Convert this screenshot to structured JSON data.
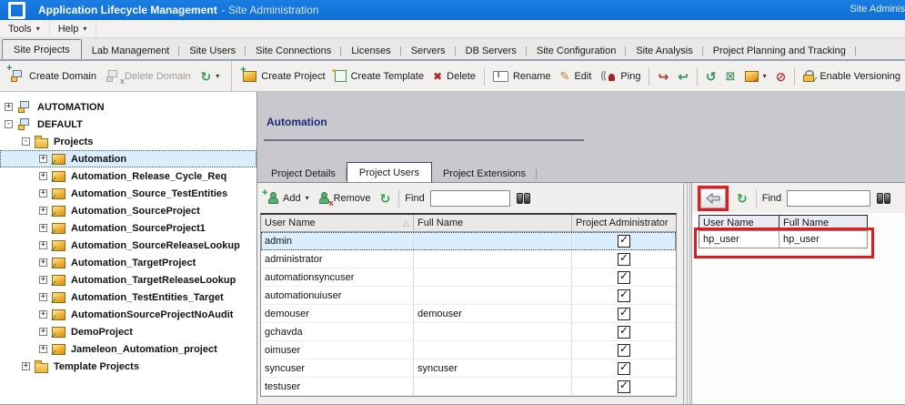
{
  "title_bar": {
    "app_title": "Application Lifecycle Management",
    "subtitle": "- Site Administration",
    "right_text": "Site Adminis"
  },
  "menu_bar": {
    "items": [
      {
        "label": "Tools"
      },
      {
        "label": "Help"
      }
    ]
  },
  "main_tabs": [
    "Site Projects",
    "Lab Management",
    "Site Users",
    "Site Connections",
    "Licenses",
    "Servers",
    "DB Servers",
    "Site Configuration",
    "Site Analysis",
    "Project Planning and Tracking"
  ],
  "toolbar": {
    "create_domain": "Create Domain",
    "delete_domain": "Delete Domain",
    "create_project": "Create Project",
    "create_template": "Create Template",
    "delete": "Delete",
    "rename": "Rename",
    "edit": "Edit",
    "ping": "Ping",
    "enable_versioning": "Enable Versioning"
  },
  "tree": {
    "items": [
      {
        "label": "AUTOMATION",
        "exp": "+",
        "icon": "domain",
        "level": 0
      },
      {
        "label": "DEFAULT",
        "exp": "-",
        "icon": "domain",
        "level": 0
      },
      {
        "label": "Projects",
        "exp": "-",
        "icon": "folder",
        "level": 1
      },
      {
        "label": "Automation",
        "exp": "+",
        "icon": "project",
        "level": 2,
        "selected": true
      },
      {
        "label": "Automation_Release_Cycle_Req",
        "exp": "+",
        "icon": "project",
        "level": 2
      },
      {
        "label": "Automation_Source_TestEntities",
        "exp": "+",
        "icon": "project",
        "level": 2
      },
      {
        "label": "Automation_SourceProject",
        "exp": "+",
        "icon": "project",
        "level": 2
      },
      {
        "label": "Automation_SourceProject1",
        "exp": "+",
        "icon": "project",
        "level": 2
      },
      {
        "label": "Automation_SourceReleaseLookup",
        "exp": "+",
        "icon": "project",
        "level": 2
      },
      {
        "label": "Automation_TargetProject",
        "exp": "+",
        "icon": "project",
        "level": 2
      },
      {
        "label": "Automation_TargetReleaseLookup",
        "exp": "+",
        "icon": "project",
        "level": 2
      },
      {
        "label": "Automation_TestEntities_Target",
        "exp": "+",
        "icon": "project",
        "level": 2
      },
      {
        "label": "AutomationSourceProjectNoAudit",
        "exp": "+",
        "icon": "project",
        "level": 2
      },
      {
        "label": "DemoProject",
        "exp": "+",
        "icon": "project",
        "level": 2
      },
      {
        "label": "Jameleon_Automation_project",
        "exp": "+",
        "icon": "project",
        "level": 2
      },
      {
        "label": "Template Projects",
        "exp": "+",
        "icon": "folder",
        "level": 1
      }
    ]
  },
  "detail": {
    "title": "Automation",
    "tabs": [
      "Project Details",
      "Project Users",
      "Project Extensions"
    ],
    "users_toolbar": {
      "add_label": "Add",
      "remove_label": "Remove",
      "find_label": "Find",
      "find_value": ""
    },
    "users_table": {
      "columns": [
        "User Name",
        "Full Name",
        "Project Administrator"
      ],
      "rows": [
        {
          "user": "admin",
          "full": "",
          "admin": true,
          "selected": true
        },
        {
          "user": "administrator",
          "full": "",
          "admin": true
        },
        {
          "user": "automationsyncuser",
          "full": "",
          "admin": true
        },
        {
          "user": "automationuiuser",
          "full": "",
          "admin": true
        },
        {
          "user": "demouser",
          "full": "demouser",
          "admin": true
        },
        {
          "user": "gchavda",
          "full": "",
          "admin": true
        },
        {
          "user": "oimuser",
          "full": "",
          "admin": true
        },
        {
          "user": "syncuser",
          "full": "syncuser",
          "admin": true
        },
        {
          "user": "testuser",
          "full": "",
          "admin": true
        }
      ]
    }
  },
  "available_panel": {
    "find_label": "Find",
    "find_value": "",
    "table": {
      "columns": [
        "User Name",
        "Full Name"
      ],
      "rows": [
        {
          "user": "hp_user",
          "full": "hp_user",
          "highlighted": true
        }
      ]
    }
  },
  "glyphs": {
    "dropdown": "▾",
    "refresh": "↻",
    "sort_ascending": "△",
    "delete_x": "✖",
    "pencil": "✎",
    "restore_arrow": "↪",
    "return_arrow": "↩",
    "undo_circle": "↺",
    "box_x": "⊠",
    "block": "⊘"
  },
  "colors": {
    "titlebar_blue": "#1173da",
    "highlight_red": "#e51a1c",
    "selection_blue": "#daeefe",
    "heading_navy": "#202a78"
  }
}
